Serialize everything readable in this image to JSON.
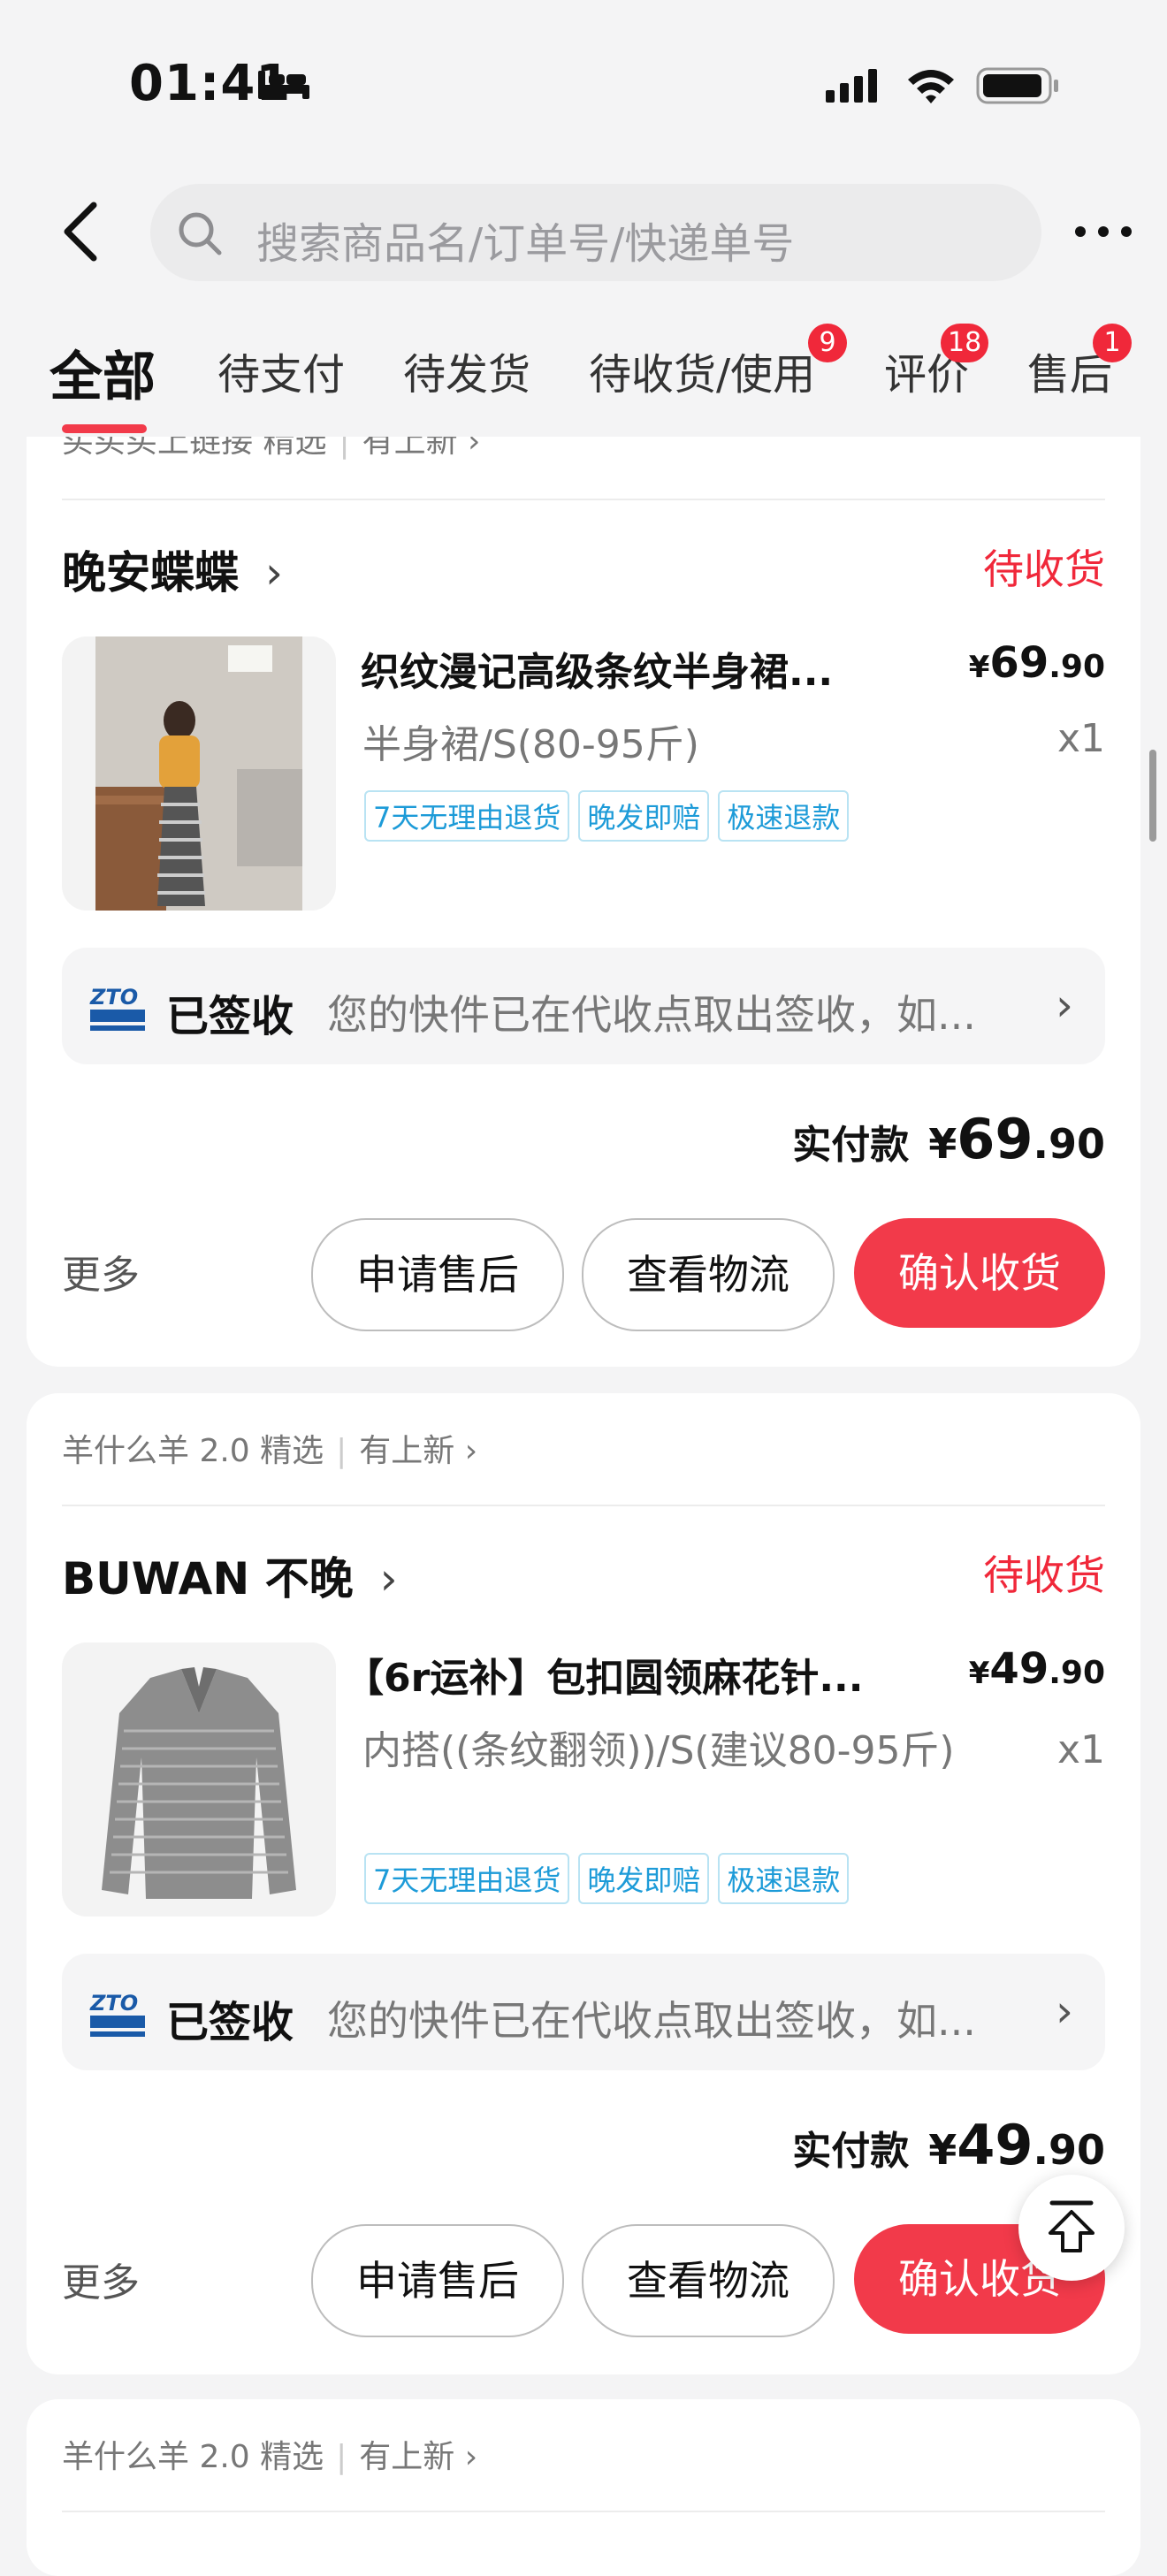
{
  "status_bar": {
    "time": "01:41"
  },
  "header": {
    "search_placeholder": "搜索商品名/订单号/快递单号"
  },
  "tabs": [
    {
      "label": "全部",
      "active": true
    },
    {
      "label": "待支付"
    },
    {
      "label": "待发货"
    },
    {
      "label": "待收货/使用",
      "badge": "9"
    },
    {
      "label": "评价",
      "badge": "18"
    },
    {
      "label": "售后",
      "badge": "1"
    }
  ],
  "partial_header_top": {
    "text": "买买买上链接 精选",
    "link": "有上新"
  },
  "orders": [
    {
      "shop": "晚安蝶蝶",
      "status": "待收货",
      "title": "织纹漫记高级条纹半身裙...",
      "price_int": "69",
      "price_dec": ".90",
      "spec": "半身裙/S(80-95斤)",
      "qty": "x1",
      "tags": [
        "7天无理由退货",
        "晚发即赔",
        "极速退款"
      ],
      "logistics_status": "已签收",
      "logistics_desc": "您的快件已在代收点取出签收，如...",
      "paid_label": "实付款",
      "paid_int": "69",
      "paid_dec": ".90",
      "more": "更多",
      "buttons": {
        "after_sale": "申请售后",
        "logistics": "查看物流",
        "confirm": "确认收货"
      }
    },
    {
      "header_text": "羊什么羊 2.0 精选",
      "header_link": "有上新",
      "shop": "BUWAN 不晚",
      "status": "待收货",
      "title": "【6r运补】包扣圆领麻花针...",
      "price_int": "49",
      "price_dec": ".90",
      "spec": "内搭((条纹翻领))/S(建议80-95斤)",
      "qty": "x1",
      "tags": [
        "7天无理由退货",
        "晚发即赔",
        "极速退款"
      ],
      "logistics_status": "已签收",
      "logistics_desc": "您的快件已在代收点取出签收，如...",
      "paid_label": "实付款",
      "paid_int": "49",
      "paid_dec": ".90",
      "more": "更多",
      "buttons": {
        "after_sale": "申请售后",
        "logistics": "查看物流",
        "confirm": "确认收货"
      }
    }
  ],
  "partial_header_bottom": {
    "text": "羊什么羊 2.0 精选",
    "link": "有上新"
  },
  "currency": "¥",
  "colors": {
    "accent": "#f23a4a",
    "tag_blue": "#1d9bd8",
    "badge_red": "#f0283a"
  },
  "icons": [
    "bed-icon",
    "signal-icon",
    "wifi-icon",
    "battery-icon",
    "back-icon",
    "search-icon",
    "more-icon",
    "zto-icon",
    "chevron-right-icon",
    "back-to-top-icon"
  ]
}
